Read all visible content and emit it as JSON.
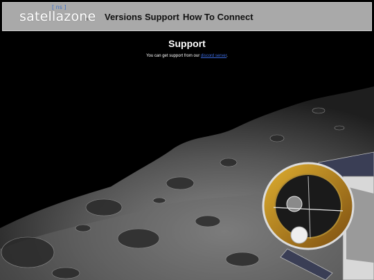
{
  "header": {
    "logo_text": "satellazone",
    "logo_badge": "[ ns ]",
    "logo_reg": "®",
    "nav": [
      {
        "label": "Versions"
      },
      {
        "label": "Support"
      },
      {
        "label": "How To Connect"
      }
    ]
  },
  "main": {
    "title": "Support",
    "message_prefix": "You can get support from our",
    "link_text": "discord server",
    "message_suffix": "."
  },
  "background": {
    "scene": "lunar surface with spacecraft",
    "colors": {
      "space": "#000000",
      "header": "#a9a9a9",
      "link": "#3b6be0"
    }
  }
}
